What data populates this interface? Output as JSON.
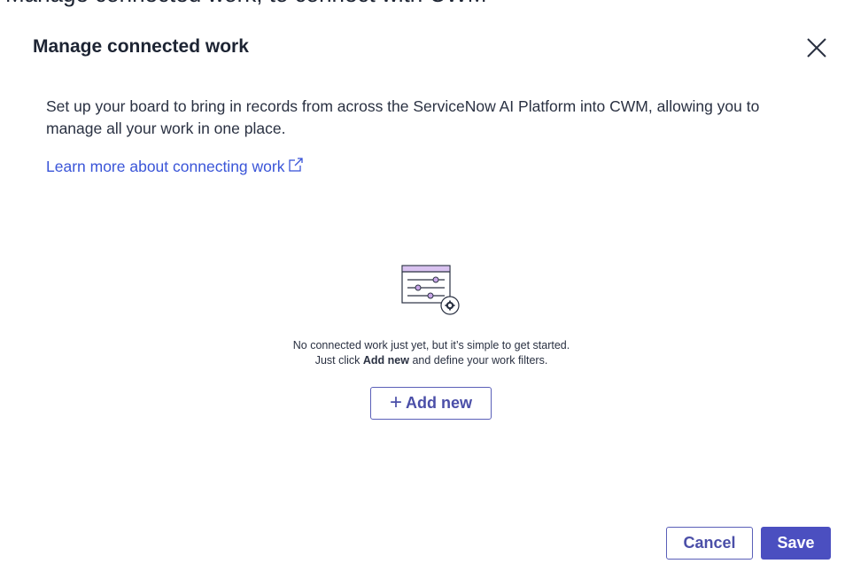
{
  "background_header": {
    "text": "Manage connected work, to connect with CWM"
  },
  "dialog": {
    "title": "Manage connected work",
    "description": "Set up your board to bring in records from across the ServiceNow AI Platform into CWM, allowing you to manage all your work in one place.",
    "learn_more_link": "Learn more about connecting work",
    "empty_state": {
      "line1": "No connected work just yet, but it’s simple to get started.",
      "line2_prefix": "Just click ",
      "line2_bold": "Add new",
      "line2_suffix": " and define your work filters."
    },
    "add_new_label": "Add new",
    "cancel_label": "Cancel",
    "save_label": "Save"
  },
  "colors": {
    "accent": "#4b4fc0",
    "link": "#3a55d8",
    "illustration_purple": "#c9a6e8"
  },
  "icons": {
    "close": "close-icon",
    "external_link": "external-link-icon",
    "empty_state": "filter-settings-illustration",
    "plus": "plus-icon"
  }
}
